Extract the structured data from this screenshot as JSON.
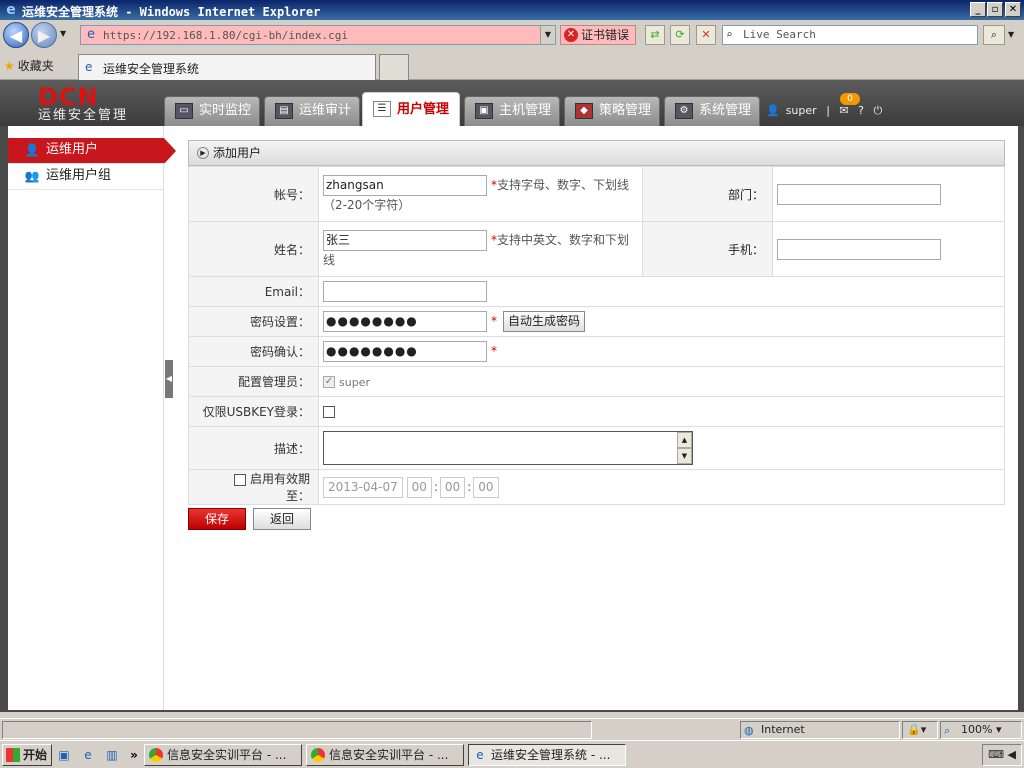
{
  "browser": {
    "title": "运维安全管理系统 - Windows Internet Explorer",
    "url": "https://192.168.1.80/cgi-bh/index.cgi",
    "cert_error": "证书错误",
    "search_placeholder": "Live Search",
    "favorites": "收藏夹",
    "tab_title": "运维安全管理系统"
  },
  "app": {
    "logo": "DCN",
    "logo_sub": "运维安全管理",
    "nav": [
      {
        "label": "实时监控"
      },
      {
        "label": "运维审计"
      },
      {
        "label": "用户管理"
      },
      {
        "label": "主机管理"
      },
      {
        "label": "策略管理"
      },
      {
        "label": "系统管理"
      }
    ],
    "user": "super",
    "badge": "0",
    "help": "?"
  },
  "sidebar": {
    "items": [
      {
        "label": "运维用户"
      },
      {
        "label": "运维用户组"
      }
    ]
  },
  "panel": {
    "title": "添加用户"
  },
  "form": {
    "account_label": "帐号：",
    "account_value": "zhangsan",
    "account_hint": "支持字母、数字、下划线（2-20个字符）",
    "department_label": "部门：",
    "department_value": "",
    "name_label": "姓名：",
    "name_value": "张三",
    "name_hint": "支持中英文、数字和下划线",
    "phone_label": "手机：",
    "phone_value": "",
    "email_label": "Email：",
    "email_value": "",
    "password_label": "密码设置：",
    "password_value": "●●●●●●●●",
    "generate_btn": "自动生成密码",
    "confirm_label": "密码确认：",
    "confirm_value": "●●●●●●●●",
    "admin_label": "配置管理员：",
    "admin_value": "super",
    "usbkey_label": "仅限USBKEY登录：",
    "desc_label": "描述：",
    "expiry_label": "启用有效期至：",
    "expiry_date": "2013-04-07",
    "expiry_h": "00",
    "expiry_m": "00",
    "expiry_s": "00",
    "required_mark": "*"
  },
  "actions": {
    "save": "保存",
    "back": "返回"
  },
  "statusbar": {
    "zone": "Internet",
    "zoom": "100%"
  },
  "taskbar": {
    "start": "开始",
    "tasks": [
      {
        "label": "信息安全实训平台 - ..."
      },
      {
        "label": "信息安全实训平台 - ..."
      },
      {
        "label": "运维安全管理系统 - ..."
      }
    ]
  }
}
